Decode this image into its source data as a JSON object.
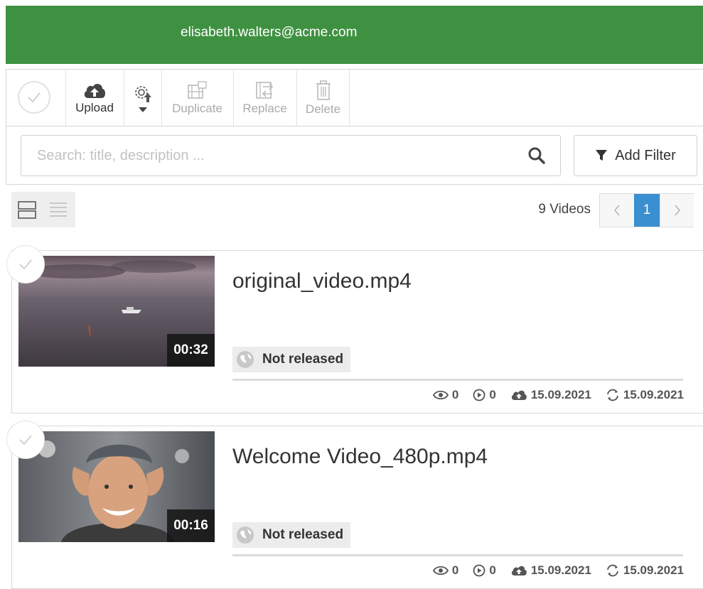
{
  "header": {
    "user_email": "elisabeth.walters@acme.com"
  },
  "toolbar": {
    "upload_label": "Upload",
    "duplicate_label": "Duplicate",
    "replace_label": "Replace",
    "delete_label": "Delete"
  },
  "search": {
    "placeholder": "Search: title, description ...",
    "value": ""
  },
  "filter": {
    "add_filter_label": "Add Filter"
  },
  "list_info": {
    "count_label": "9 Videos",
    "current_page": "1"
  },
  "videos": [
    {
      "title": "original_video.mp4",
      "duration": "00:32",
      "status": "Not released",
      "views": "0",
      "plays": "0",
      "uploaded": "15.09.2021",
      "updated": "15.09.2021"
    },
    {
      "title": "Welcome Video_480p.mp4",
      "duration": "00:16",
      "status": "Not released",
      "views": "0",
      "plays": "0",
      "uploaded": "15.09.2021",
      "updated": "15.09.2021"
    }
  ],
  "colors": {
    "header_green": "#3f9142",
    "active_page_blue": "#3a8fd0"
  }
}
